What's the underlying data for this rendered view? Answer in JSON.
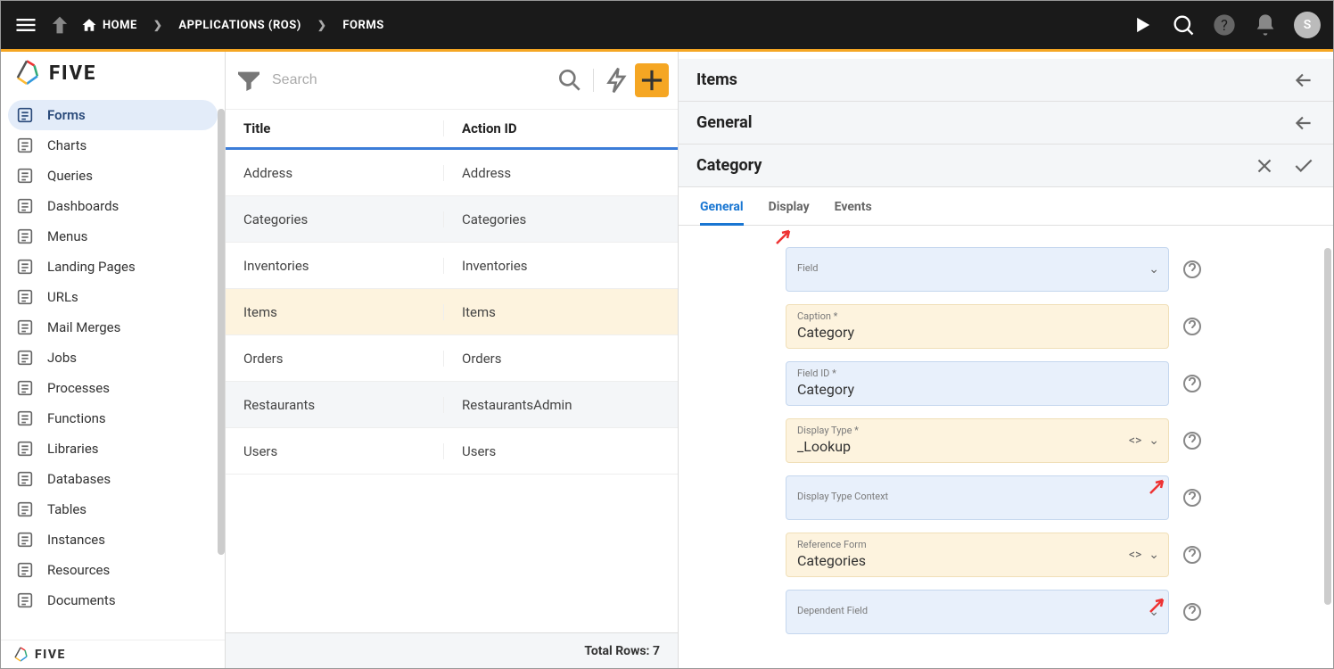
{
  "topbar": {
    "home": "HOME",
    "crumb1": "APPLICATIONS (ROS)",
    "crumb2": "FORMS",
    "avatar": "S"
  },
  "brand": "FIVE",
  "nav": [
    {
      "label": "Forms",
      "active": true
    },
    {
      "label": "Charts"
    },
    {
      "label": "Queries"
    },
    {
      "label": "Dashboards"
    },
    {
      "label": "Menus"
    },
    {
      "label": "Landing Pages"
    },
    {
      "label": "URLs"
    },
    {
      "label": "Mail Merges"
    },
    {
      "label": "Jobs"
    },
    {
      "label": "Processes"
    },
    {
      "label": "Functions"
    },
    {
      "label": "Libraries"
    },
    {
      "label": "Databases"
    },
    {
      "label": "Tables"
    },
    {
      "label": "Instances"
    },
    {
      "label": "Resources"
    },
    {
      "label": "Documents"
    }
  ],
  "search": {
    "placeholder": "Search"
  },
  "table": {
    "col1": "Title",
    "col2": "Action ID",
    "rows": [
      {
        "title": "Address",
        "action": "Address"
      },
      {
        "title": "Categories",
        "action": "Categories"
      },
      {
        "title": "Inventories",
        "action": "Inventories"
      },
      {
        "title": "Items",
        "action": "Items",
        "selected": true
      },
      {
        "title": "Orders",
        "action": "Orders"
      },
      {
        "title": "Restaurants",
        "action": "RestaurantsAdmin"
      },
      {
        "title": "Users",
        "action": "Users"
      }
    ],
    "footer": "Total Rows: 7"
  },
  "panels": {
    "p1": "Items",
    "p2": "General",
    "p3": "Category"
  },
  "tabs": [
    "General",
    "Display",
    "Events"
  ],
  "fields": {
    "field_label": "Field",
    "caption_label": "Caption *",
    "caption_value": "Category",
    "fieldid_label": "Field ID *",
    "fieldid_value": "Category",
    "dtype_label": "Display Type *",
    "dtype_value": "_Lookup",
    "dctx_label": "Display Type Context",
    "refform_label": "Reference Form",
    "refform_value": "Categories",
    "depfield_label": "Dependent Field"
  }
}
